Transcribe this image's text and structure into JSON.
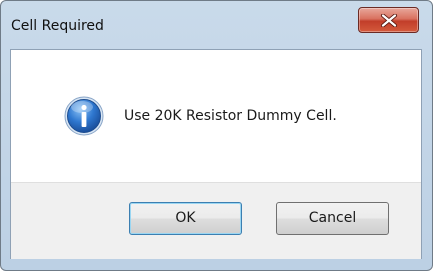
{
  "dialog": {
    "title": "Cell Required",
    "message": "Use 20K Resistor Dummy Cell.",
    "icon": "information-icon",
    "buttons": {
      "ok_label": "OK",
      "cancel_label": "Cancel"
    }
  },
  "colors": {
    "close_button": "#c94a34",
    "info_icon": "#1f5fb5",
    "default_button_border": "#3c7fb1"
  }
}
